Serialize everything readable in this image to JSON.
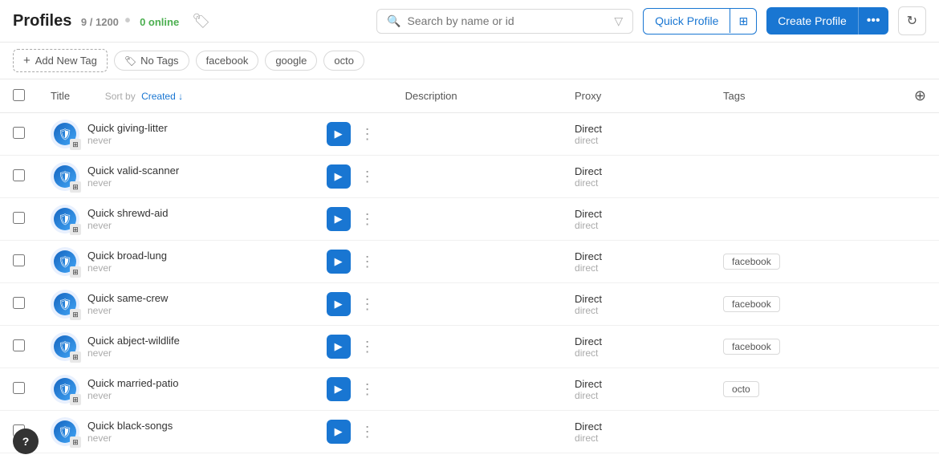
{
  "header": {
    "title": "Profiles",
    "count": "9 / 1200",
    "online_label": "0 online",
    "search_placeholder": "Search by name or id",
    "quick_profile_label": "Quick Profile",
    "create_profile_label": "Create Profile"
  },
  "tags_bar": {
    "add_tag_label": "Add New Tag",
    "tags": [
      {
        "id": "no-tags",
        "label": "No Tags",
        "icon": true
      },
      {
        "id": "facebook",
        "label": "facebook"
      },
      {
        "id": "google",
        "label": "google"
      },
      {
        "id": "octo",
        "label": "octo"
      }
    ]
  },
  "table": {
    "columns": {
      "title": "Title",
      "sort_by": "Sort by",
      "sort_field": "Created",
      "description": "Description",
      "proxy": "Proxy",
      "tags": "Tags"
    },
    "rows": [
      {
        "id": 1,
        "name": "Quick giving-litter",
        "sub": "never",
        "proxy_name": "Direct",
        "proxy_sub": "direct",
        "tags": []
      },
      {
        "id": 2,
        "name": "Quick valid-scanner",
        "sub": "never",
        "proxy_name": "Direct",
        "proxy_sub": "direct",
        "tags": []
      },
      {
        "id": 3,
        "name": "Quick shrewd-aid",
        "sub": "never",
        "proxy_name": "Direct",
        "proxy_sub": "direct",
        "tags": []
      },
      {
        "id": 4,
        "name": "Quick broad-lung",
        "sub": "never",
        "proxy_name": "Direct",
        "proxy_sub": "direct",
        "tags": [
          "facebook"
        ]
      },
      {
        "id": 5,
        "name": "Quick same-crew",
        "sub": "never",
        "proxy_name": "Direct",
        "proxy_sub": "direct",
        "tags": [
          "facebook"
        ]
      },
      {
        "id": 6,
        "name": "Quick abject-wildlife",
        "sub": "never",
        "proxy_name": "Direct",
        "proxy_sub": "direct",
        "tags": [
          "facebook"
        ]
      },
      {
        "id": 7,
        "name": "Quick married-patio",
        "sub": "never",
        "proxy_name": "Direct",
        "proxy_sub": "direct",
        "tags": [
          "octo"
        ]
      },
      {
        "id": 8,
        "name": "Quick black-songs",
        "sub": "never",
        "proxy_name": "Direct",
        "proxy_sub": "direct",
        "tags": []
      }
    ]
  },
  "icons": {
    "search": "⌕",
    "filter": "▽",
    "grid": "⊞",
    "dots": "•••",
    "refresh": "↻",
    "plus": "+",
    "play": "▶",
    "more": "⋮",
    "shield": "🛡",
    "windows": "⊞",
    "tag": "🏷",
    "sort_down": "↓",
    "add_col": "⊕",
    "cursor": "↖"
  }
}
